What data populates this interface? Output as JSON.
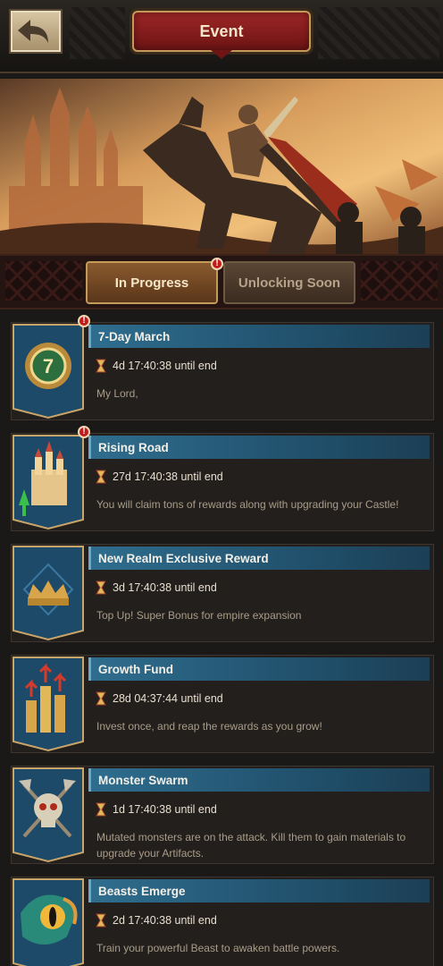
{
  "header": {
    "title": "Event"
  },
  "tabs": [
    {
      "label": "In Progress",
      "active": true,
      "has_alert": true
    },
    {
      "label": "Unlocking Soon",
      "active": false,
      "has_alert": false
    }
  ],
  "alert_glyph": "!",
  "events": [
    {
      "title": "7-Day March",
      "timer": "4d 17:40:38 until end",
      "description": "My Lord,",
      "has_alert": true,
      "icon": "seven-medal-icon"
    },
    {
      "title": "Rising Road",
      "timer": "27d 17:40:38 until end",
      "description": "You will claim tons of rewards along with upgrading your Castle!",
      "has_alert": true,
      "icon": "castle-upgrade-icon"
    },
    {
      "title": "New Realm Exclusive Reward",
      "timer": "3d 17:40:38 until end",
      "description": "Top Up! Super Bonus for empire expansion",
      "has_alert": false,
      "icon": "crown-icon"
    },
    {
      "title": "Growth Fund",
      "timer": "28d 04:37:44 until end",
      "description": "Invest once, and reap the rewards as you grow!",
      "has_alert": false,
      "icon": "gold-growth-icon"
    },
    {
      "title": "Monster Swarm",
      "timer": "1d 17:40:38 until end",
      "description": "Mutated monsters are on the attack. Kill them to gain materials to upgrade your Artifacts.",
      "has_alert": false,
      "icon": "skull-axes-icon"
    },
    {
      "title": "Beasts Emerge",
      "timer": "2d 17:40:38 until end",
      "description": "Train your powerful Beast to awaken battle powers.",
      "has_alert": false,
      "icon": "beast-eye-icon"
    }
  ]
}
